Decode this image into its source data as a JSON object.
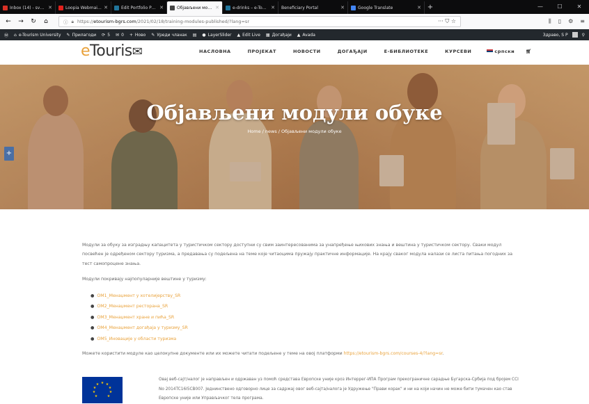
{
  "browser": {
    "tabs": [
      {
        "title": "Inbox (14) - sveta.pantic@p...",
        "color": "#d93025",
        "active": false
      },
      {
        "title": "Loopia Webmail :: Inbox",
        "color": "#e2211c",
        "active": false
      },
      {
        "title": "Edit Portfolio Post ‹ e-Touris...",
        "color": "#21759b",
        "active": false
      },
      {
        "title": "Објављени модули обуке",
        "color": "#444444",
        "active": true
      },
      {
        "title": "e-drinks – e-Tourism Univers...",
        "color": "#21759b",
        "active": false
      },
      {
        "title": "Beneficiary Portal",
        "color": "#5b8ed6",
        "active": false
      },
      {
        "title": "Google Translate",
        "color": "#4285f4",
        "active": false
      }
    ],
    "url_prefix": "https://",
    "url_domain": "etourism-bgrs.com",
    "url_path": "/2021/02/18/training-modules-published/?lang=sr",
    "url_actions": "··· ⛉ ☆"
  },
  "wpbar": {
    "items": [
      "e-Tourism University",
      "Прилагоди",
      "5",
      "0",
      "Ново",
      "Уреди чланак",
      "",
      "LayerSlider",
      "Edit Live",
      "Догађаји",
      "Avada"
    ],
    "greeting": "Здраво, S P"
  },
  "site": {
    "logo_prefix": "e",
    "logo_rest": "Touris",
    "menu": [
      "НАСЛОВНА",
      "ПРОЈЕКАТ",
      "НОВОСТИ",
      "ДОГАЂАЈИ",
      "Е-БИБЛИОТЕКЕ",
      "КУРСЕВИ",
      "српски"
    ]
  },
  "hero": {
    "title": "Објављени модули обуке",
    "breadcrumb": "Home / news / Објављени модули обуке"
  },
  "content": {
    "intro": "Модули за обуку за изградњу капацитета у туристичком сектору доступни су свим заинтересованима за унапређење њихових знања и вештина у туристичком сектору. Сваки модул посвећен је одређеном сектору туризма, а предавања су подељена на теме које читаоцима пружају практичне информације. На крају сваког модула налази се листа питања погодних за тест самопроцене знања.",
    "skills_intro": "Модули покривају најпопуларније вештине у туризму:",
    "modules": [
      "OM1_Менаџмент у хотелијерству_SR",
      "OM2_Менаџмент ресторана_SR",
      "OM3_Менаџмент хране и пића_SR",
      "OM4_Менаџмент догађаја у туризму_SR",
      "OM5_Иновације у области туризма"
    ],
    "closing_text": "Можете користити модуле као целокупне документе или их можете читати подељене у теме на овој платформи ",
    "closing_link": "https://etourism-bgrs.com/courses-4/?lang=sr",
    "closing_end": ".",
    "eu_text": "Овај веб-сајт/налог је направљен и одржаван уз помоћ средстава Европске уније кроз Интеррег-ИПА Програм прекограничне сарадње Бугарска-Србија под бројем CCI No 2014TC16I5CB007. Једнинствено одговорно лице за садржај овог веб-сајта/налога је Удружење \"Прави корак\" и ни на који начин не може бити тумачен као став Европске уније или Управљачког тела програма."
  }
}
